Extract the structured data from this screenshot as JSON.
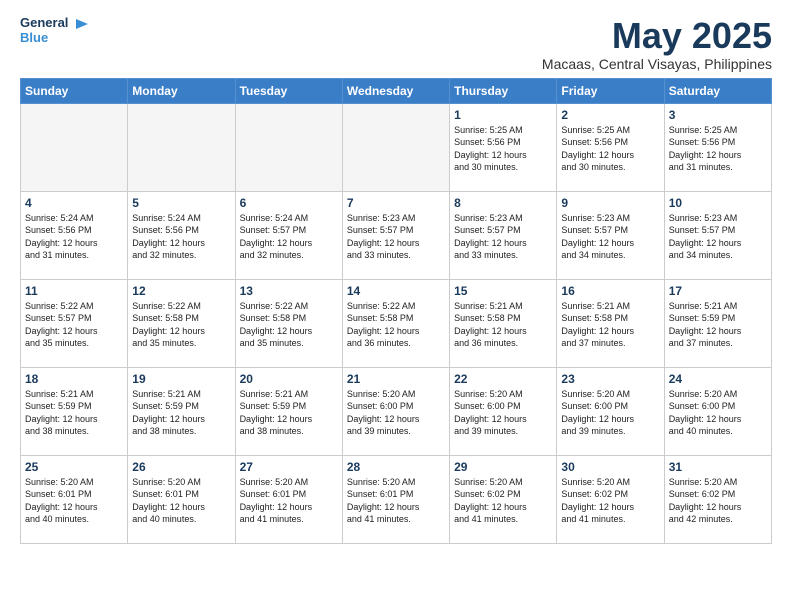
{
  "header": {
    "logo_line1": "General",
    "logo_line2": "Blue",
    "title": "May 2025",
    "subtitle": "Macaas, Central Visayas, Philippines"
  },
  "days_of_week": [
    "Sunday",
    "Monday",
    "Tuesday",
    "Wednesday",
    "Thursday",
    "Friday",
    "Saturday"
  ],
  "weeks": [
    [
      {
        "day": "",
        "text": ""
      },
      {
        "day": "",
        "text": ""
      },
      {
        "day": "",
        "text": ""
      },
      {
        "day": "",
        "text": ""
      },
      {
        "day": "1",
        "text": "Sunrise: 5:25 AM\nSunset: 5:56 PM\nDaylight: 12 hours\nand 30 minutes."
      },
      {
        "day": "2",
        "text": "Sunrise: 5:25 AM\nSunset: 5:56 PM\nDaylight: 12 hours\nand 30 minutes."
      },
      {
        "day": "3",
        "text": "Sunrise: 5:25 AM\nSunset: 5:56 PM\nDaylight: 12 hours\nand 31 minutes."
      }
    ],
    [
      {
        "day": "4",
        "text": "Sunrise: 5:24 AM\nSunset: 5:56 PM\nDaylight: 12 hours\nand 31 minutes."
      },
      {
        "day": "5",
        "text": "Sunrise: 5:24 AM\nSunset: 5:56 PM\nDaylight: 12 hours\nand 32 minutes."
      },
      {
        "day": "6",
        "text": "Sunrise: 5:24 AM\nSunset: 5:57 PM\nDaylight: 12 hours\nand 32 minutes."
      },
      {
        "day": "7",
        "text": "Sunrise: 5:23 AM\nSunset: 5:57 PM\nDaylight: 12 hours\nand 33 minutes."
      },
      {
        "day": "8",
        "text": "Sunrise: 5:23 AM\nSunset: 5:57 PM\nDaylight: 12 hours\nand 33 minutes."
      },
      {
        "day": "9",
        "text": "Sunrise: 5:23 AM\nSunset: 5:57 PM\nDaylight: 12 hours\nand 34 minutes."
      },
      {
        "day": "10",
        "text": "Sunrise: 5:23 AM\nSunset: 5:57 PM\nDaylight: 12 hours\nand 34 minutes."
      }
    ],
    [
      {
        "day": "11",
        "text": "Sunrise: 5:22 AM\nSunset: 5:57 PM\nDaylight: 12 hours\nand 35 minutes."
      },
      {
        "day": "12",
        "text": "Sunrise: 5:22 AM\nSunset: 5:58 PM\nDaylight: 12 hours\nand 35 minutes."
      },
      {
        "day": "13",
        "text": "Sunrise: 5:22 AM\nSunset: 5:58 PM\nDaylight: 12 hours\nand 35 minutes."
      },
      {
        "day": "14",
        "text": "Sunrise: 5:22 AM\nSunset: 5:58 PM\nDaylight: 12 hours\nand 36 minutes."
      },
      {
        "day": "15",
        "text": "Sunrise: 5:21 AM\nSunset: 5:58 PM\nDaylight: 12 hours\nand 36 minutes."
      },
      {
        "day": "16",
        "text": "Sunrise: 5:21 AM\nSunset: 5:58 PM\nDaylight: 12 hours\nand 37 minutes."
      },
      {
        "day": "17",
        "text": "Sunrise: 5:21 AM\nSunset: 5:59 PM\nDaylight: 12 hours\nand 37 minutes."
      }
    ],
    [
      {
        "day": "18",
        "text": "Sunrise: 5:21 AM\nSunset: 5:59 PM\nDaylight: 12 hours\nand 38 minutes."
      },
      {
        "day": "19",
        "text": "Sunrise: 5:21 AM\nSunset: 5:59 PM\nDaylight: 12 hours\nand 38 minutes."
      },
      {
        "day": "20",
        "text": "Sunrise: 5:21 AM\nSunset: 5:59 PM\nDaylight: 12 hours\nand 38 minutes."
      },
      {
        "day": "21",
        "text": "Sunrise: 5:20 AM\nSunset: 6:00 PM\nDaylight: 12 hours\nand 39 minutes."
      },
      {
        "day": "22",
        "text": "Sunrise: 5:20 AM\nSunset: 6:00 PM\nDaylight: 12 hours\nand 39 minutes."
      },
      {
        "day": "23",
        "text": "Sunrise: 5:20 AM\nSunset: 6:00 PM\nDaylight: 12 hours\nand 39 minutes."
      },
      {
        "day": "24",
        "text": "Sunrise: 5:20 AM\nSunset: 6:00 PM\nDaylight: 12 hours\nand 40 minutes."
      }
    ],
    [
      {
        "day": "25",
        "text": "Sunrise: 5:20 AM\nSunset: 6:01 PM\nDaylight: 12 hours\nand 40 minutes."
      },
      {
        "day": "26",
        "text": "Sunrise: 5:20 AM\nSunset: 6:01 PM\nDaylight: 12 hours\nand 40 minutes."
      },
      {
        "day": "27",
        "text": "Sunrise: 5:20 AM\nSunset: 6:01 PM\nDaylight: 12 hours\nand 41 minutes."
      },
      {
        "day": "28",
        "text": "Sunrise: 5:20 AM\nSunset: 6:01 PM\nDaylight: 12 hours\nand 41 minutes."
      },
      {
        "day": "29",
        "text": "Sunrise: 5:20 AM\nSunset: 6:02 PM\nDaylight: 12 hours\nand 41 minutes."
      },
      {
        "day": "30",
        "text": "Sunrise: 5:20 AM\nSunset: 6:02 PM\nDaylight: 12 hours\nand 41 minutes."
      },
      {
        "day": "31",
        "text": "Sunrise: 5:20 AM\nSunset: 6:02 PM\nDaylight: 12 hours\nand 42 minutes."
      }
    ]
  ]
}
